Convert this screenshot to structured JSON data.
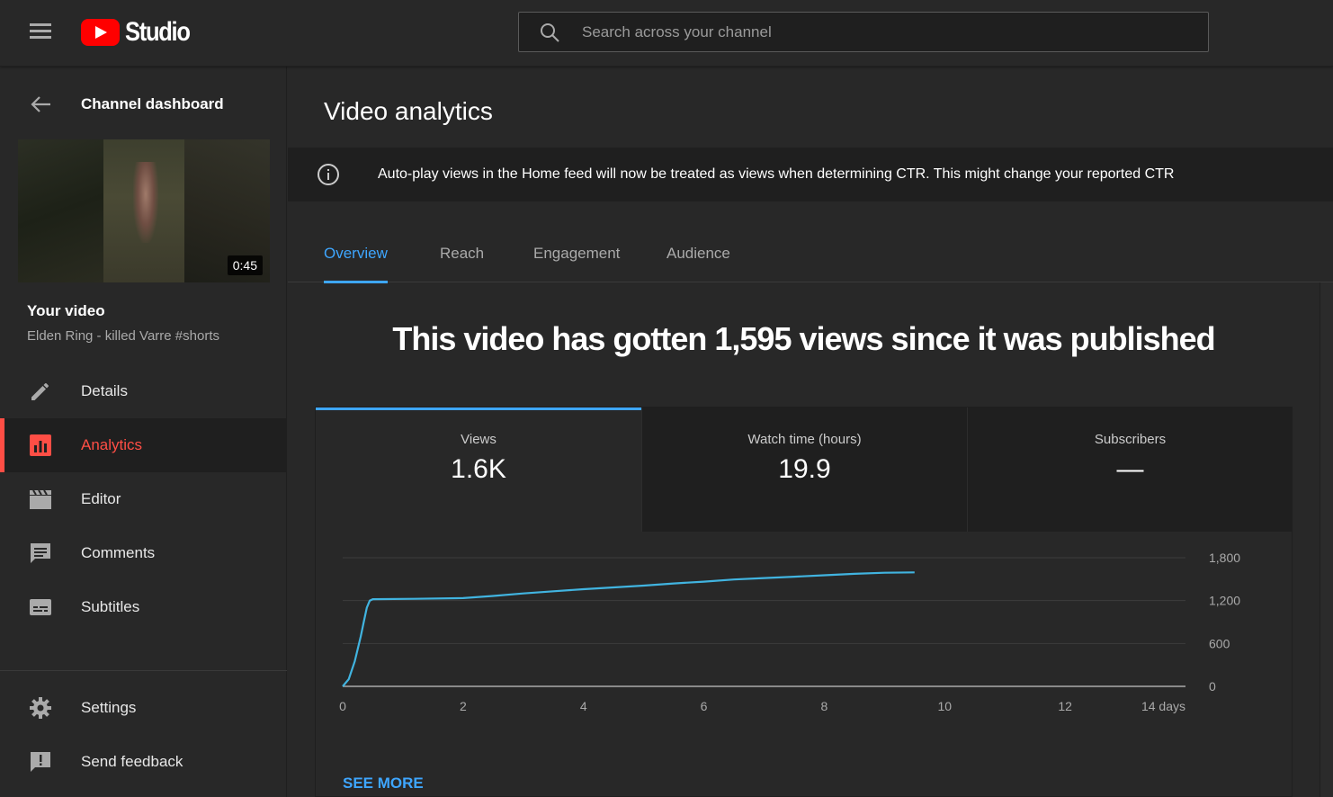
{
  "header": {
    "logo_text": "Studio",
    "search_placeholder": "Search across your channel"
  },
  "sidebar": {
    "back_label": "Channel dashboard",
    "video_duration": "0:45",
    "your_video_label": "Your video",
    "video_title": "Elden Ring - killed Varre #shorts",
    "nav": [
      {
        "label": "Details",
        "icon": "pencil-icon"
      },
      {
        "label": "Analytics",
        "icon": "analytics-icon",
        "active": true
      },
      {
        "label": "Editor",
        "icon": "clapperboard-icon"
      },
      {
        "label": "Comments",
        "icon": "comment-icon"
      },
      {
        "label": "Subtitles",
        "icon": "subtitles-icon"
      }
    ],
    "bottom_nav": [
      {
        "label": "Settings",
        "icon": "gear-icon"
      },
      {
        "label": "Send feedback",
        "icon": "feedback-icon"
      }
    ]
  },
  "main": {
    "title": "Video analytics",
    "banner_text": "Auto-play views in the Home feed will now be treated as views when determining CTR. This might change your reported CTR",
    "tabs": [
      "Overview",
      "Reach",
      "Engagement",
      "Audience"
    ],
    "active_tab": "Overview",
    "headline": "This video has gotten 1,595 views since it was published",
    "metrics": [
      {
        "label": "Views",
        "value": "1.6K"
      },
      {
        "label": "Watch time (hours)",
        "value": "19.9"
      },
      {
        "label": "Subscribers",
        "value": "—"
      }
    ],
    "see_more": "SEE MORE"
  },
  "colors": {
    "accent_blue": "#3ea6ff",
    "active_red": "#ff4e45",
    "line": "#41b4e0",
    "brand_red": "#ff0000"
  },
  "chart_data": {
    "type": "line",
    "xlabel": "",
    "ylabel": "",
    "x_unit_label": "days",
    "xlim": [
      0,
      14
    ],
    "ylim": [
      0,
      1800
    ],
    "x_ticks": [
      0,
      2,
      4,
      6,
      8,
      10,
      12,
      14
    ],
    "x_tick_labels": [
      "0",
      "2",
      "4",
      "6",
      "8",
      "10",
      "12",
      "14 days"
    ],
    "y_ticks": [
      0,
      600,
      1200,
      1800
    ],
    "y_tick_labels": [
      "0",
      "600",
      "1,200",
      "1,800"
    ],
    "grid": true,
    "series": [
      {
        "x": [
          0,
          0.1,
          0.2,
          0.3,
          0.35,
          0.4,
          0.45,
          0.5,
          1.2,
          2.0,
          2.5,
          3.0,
          3.5,
          4.0,
          4.5,
          5.0,
          5.5,
          6.0,
          6.5,
          7.0,
          7.5,
          8.0,
          8.5,
          9.0,
          9.5
        ],
        "y": [
          0,
          100,
          350,
          700,
          900,
          1100,
          1200,
          1220,
          1225,
          1235,
          1265,
          1300,
          1330,
          1360,
          1385,
          1410,
          1440,
          1465,
          1495,
          1515,
          1535,
          1555,
          1575,
          1590,
          1595
        ]
      }
    ]
  }
}
